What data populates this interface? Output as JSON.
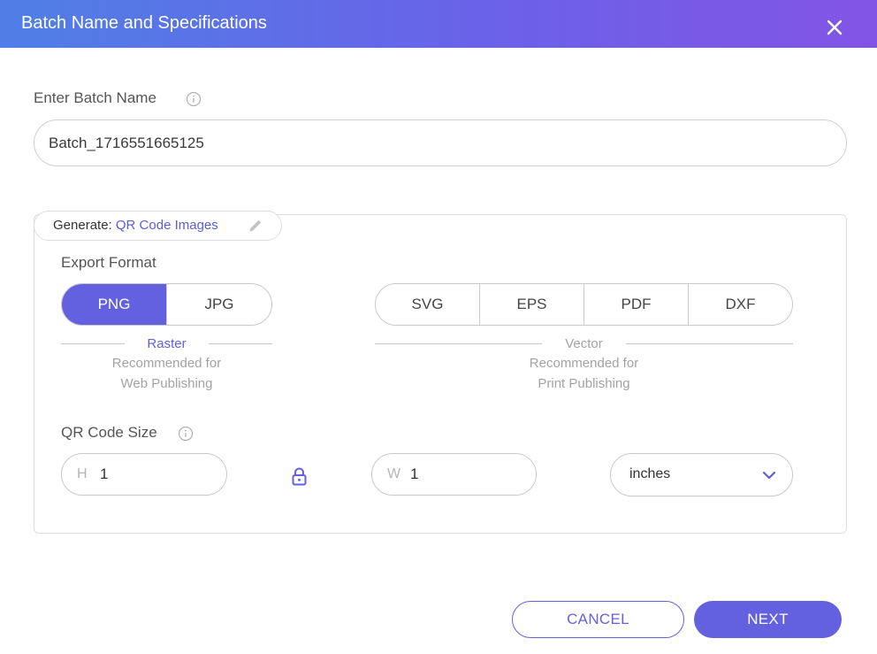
{
  "dialog": {
    "title": "Batch Name and Specifications"
  },
  "batch": {
    "label": "Enter Batch Name",
    "value": "Batch_1716551665125"
  },
  "generate": {
    "label": "Generate:",
    "value": "QR Code Images"
  },
  "export": {
    "label": "Export Format",
    "raster": {
      "options": [
        "PNG",
        "JPG"
      ],
      "selected": "PNG",
      "category": "Raster",
      "note_line1": "Recommended for",
      "note_line2": "Web Publishing"
    },
    "vector": {
      "options": [
        "SVG",
        "EPS",
        "PDF",
        "DXF"
      ],
      "category": "Vector",
      "note_line1": "Recommended for",
      "note_line2": "Print Publishing"
    }
  },
  "size": {
    "label": "QR Code Size",
    "height_prefix": "H",
    "height_value": "1",
    "width_prefix": "W",
    "width_value": "1",
    "unit": "inches"
  },
  "actions": {
    "cancel": "CANCEL",
    "next": "NEXT"
  },
  "colors": {
    "accent": "#6461e0",
    "header_start": "#4f7fe6",
    "header_end": "#8354e6",
    "muted": "#a3a3a3"
  },
  "icons": {
    "close": "close-icon",
    "info": "info-icon",
    "edit": "pencil-icon",
    "lock": "lock-icon",
    "dropdown": "chevron-down-icon"
  }
}
